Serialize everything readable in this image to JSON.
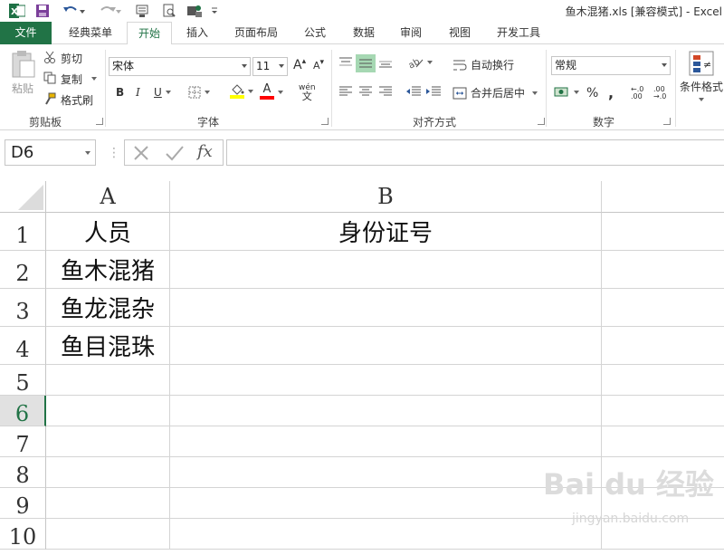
{
  "window": {
    "title": "鱼木混猪.xls  [兼容模式] - Excel"
  },
  "quick_access": {
    "icons": [
      "excel-logo-icon",
      "save-icon",
      "undo-icon",
      "redo-icon",
      "touch-mode-icon",
      "print-preview-icon",
      "share-icon",
      "customize-icon"
    ]
  },
  "tabs": [
    {
      "label": "文件"
    },
    {
      "label": "经典菜单"
    },
    {
      "label": "开始"
    },
    {
      "label": "插入"
    },
    {
      "label": "页面布局"
    },
    {
      "label": "公式"
    },
    {
      "label": "数据"
    },
    {
      "label": "审阅"
    },
    {
      "label": "视图"
    },
    {
      "label": "开发工具"
    }
  ],
  "ribbon": {
    "clipboard": {
      "paste": "粘贴",
      "cut": "剪切",
      "copy": "复制",
      "format_painter": "格式刷",
      "group_label": "剪贴板"
    },
    "font": {
      "font_name": "宋体",
      "font_size": "11",
      "grow": "A",
      "shrink": "A",
      "bold": "B",
      "italic": "I",
      "underline": "U",
      "font_color_letter": "A",
      "phonetic": "wén",
      "group_label": "字体",
      "fill_color": "#ffff00",
      "text_color": "#ff0000"
    },
    "alignment": {
      "wrap_text": "自动换行",
      "merge_center": "合并后居中",
      "group_label": "对齐方式"
    },
    "number": {
      "format": "常规",
      "percent": "%",
      "comma": ",",
      "group_label": "数字"
    },
    "styles": {
      "conditional_format": "条件格式"
    }
  },
  "formula_bar": {
    "name_box": "D6",
    "fx": "fx",
    "formula": ""
  },
  "sheet": {
    "columns": [
      "A",
      "B"
    ],
    "rows": [
      "1",
      "2",
      "3",
      "4",
      "5",
      "6",
      "7",
      "8",
      "9",
      "10"
    ],
    "cells": {
      "A1": "人员",
      "B1": "身份证号",
      "A2": "鱼木混猪",
      "A3": "鱼龙混杂",
      "A4": "鱼目混珠"
    }
  },
  "watermark": {
    "main": "Bai du 经验",
    "sub": "jingyan.baidu.com"
  },
  "colors": {
    "accent": "#217346",
    "grid_line": "#d4d4d4"
  }
}
